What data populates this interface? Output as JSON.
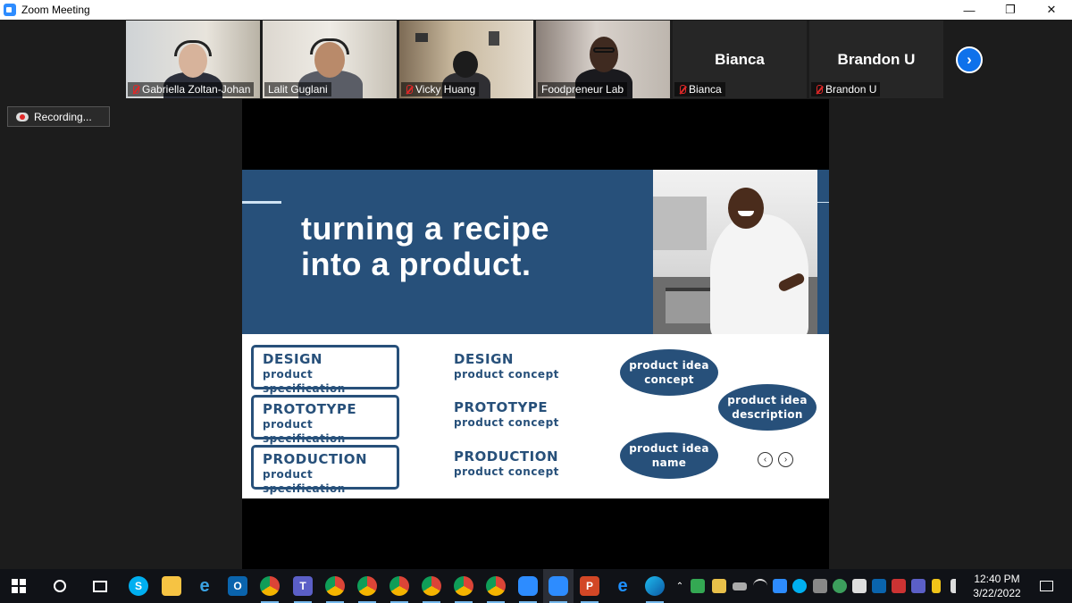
{
  "window": {
    "title": "Zoom Meeting",
    "minimize_glyph": "—",
    "restore_glyph": "❐",
    "close_glyph": "✕"
  },
  "participants": [
    {
      "name": "Gabriella Zoltan-Johan",
      "muted": true
    },
    {
      "name": "Lalit Guglani",
      "muted": false
    },
    {
      "name": "Vicky Huang",
      "muted": true
    },
    {
      "name": "Foodpreneur Lab",
      "muted": false,
      "active_speaker": true
    },
    {
      "name": "Bianca",
      "display_name": "Bianca",
      "muted": true,
      "video": false
    },
    {
      "name": "Brandon U",
      "display_name": "Brandon U",
      "muted": true,
      "video": false
    }
  ],
  "next_page_glyph": "›",
  "recording": {
    "label": "Recording..."
  },
  "slide": {
    "headline": "turning a recipe into a product.",
    "specs": [
      {
        "title": "DESIGN",
        "subtitle": "product  specification"
      },
      {
        "title": "PROTOTYPE",
        "subtitle": "product  specification"
      },
      {
        "title": "PRODUCTION",
        "subtitle": "product  specification"
      }
    ],
    "concepts": [
      {
        "title": "DESIGN",
        "subtitle": "product  concept"
      },
      {
        "title": "PROTOTYPE",
        "subtitle": "product  concept"
      },
      {
        "title": "PRODUCTION",
        "subtitle": "product  concept"
      }
    ],
    "bubbles": [
      {
        "text": "product idea concept"
      },
      {
        "text": "product idea description"
      },
      {
        "text": "product idea name"
      }
    ],
    "prev_glyph": "‹",
    "next_glyph": "›"
  },
  "colors": {
    "brand_blue": "#27507a",
    "zoom_blue": "#0e71eb",
    "active_speaker": "#8bd04b",
    "muted_red": "#e02828"
  },
  "taskbar": {
    "clock_time": "12:40 PM",
    "clock_date": "3/22/2022",
    "apps": [
      "windows-start-icon",
      "cortana-icon",
      "task-view-icon",
      "skype-icon",
      "file-explorer-icon",
      "internet-explorer-icon",
      "outlook-icon",
      "chrome-icon",
      "teams-icon",
      "chrome-profile-icon",
      "chrome-profile-icon",
      "chrome-profile-icon",
      "chrome-profile-icon",
      "chrome-profile-icon",
      "chrome-profile-icon",
      "zoom-icon",
      "zoom-icon",
      "powerpoint-icon",
      "edge-legacy-icon",
      "edge-icon"
    ]
  }
}
